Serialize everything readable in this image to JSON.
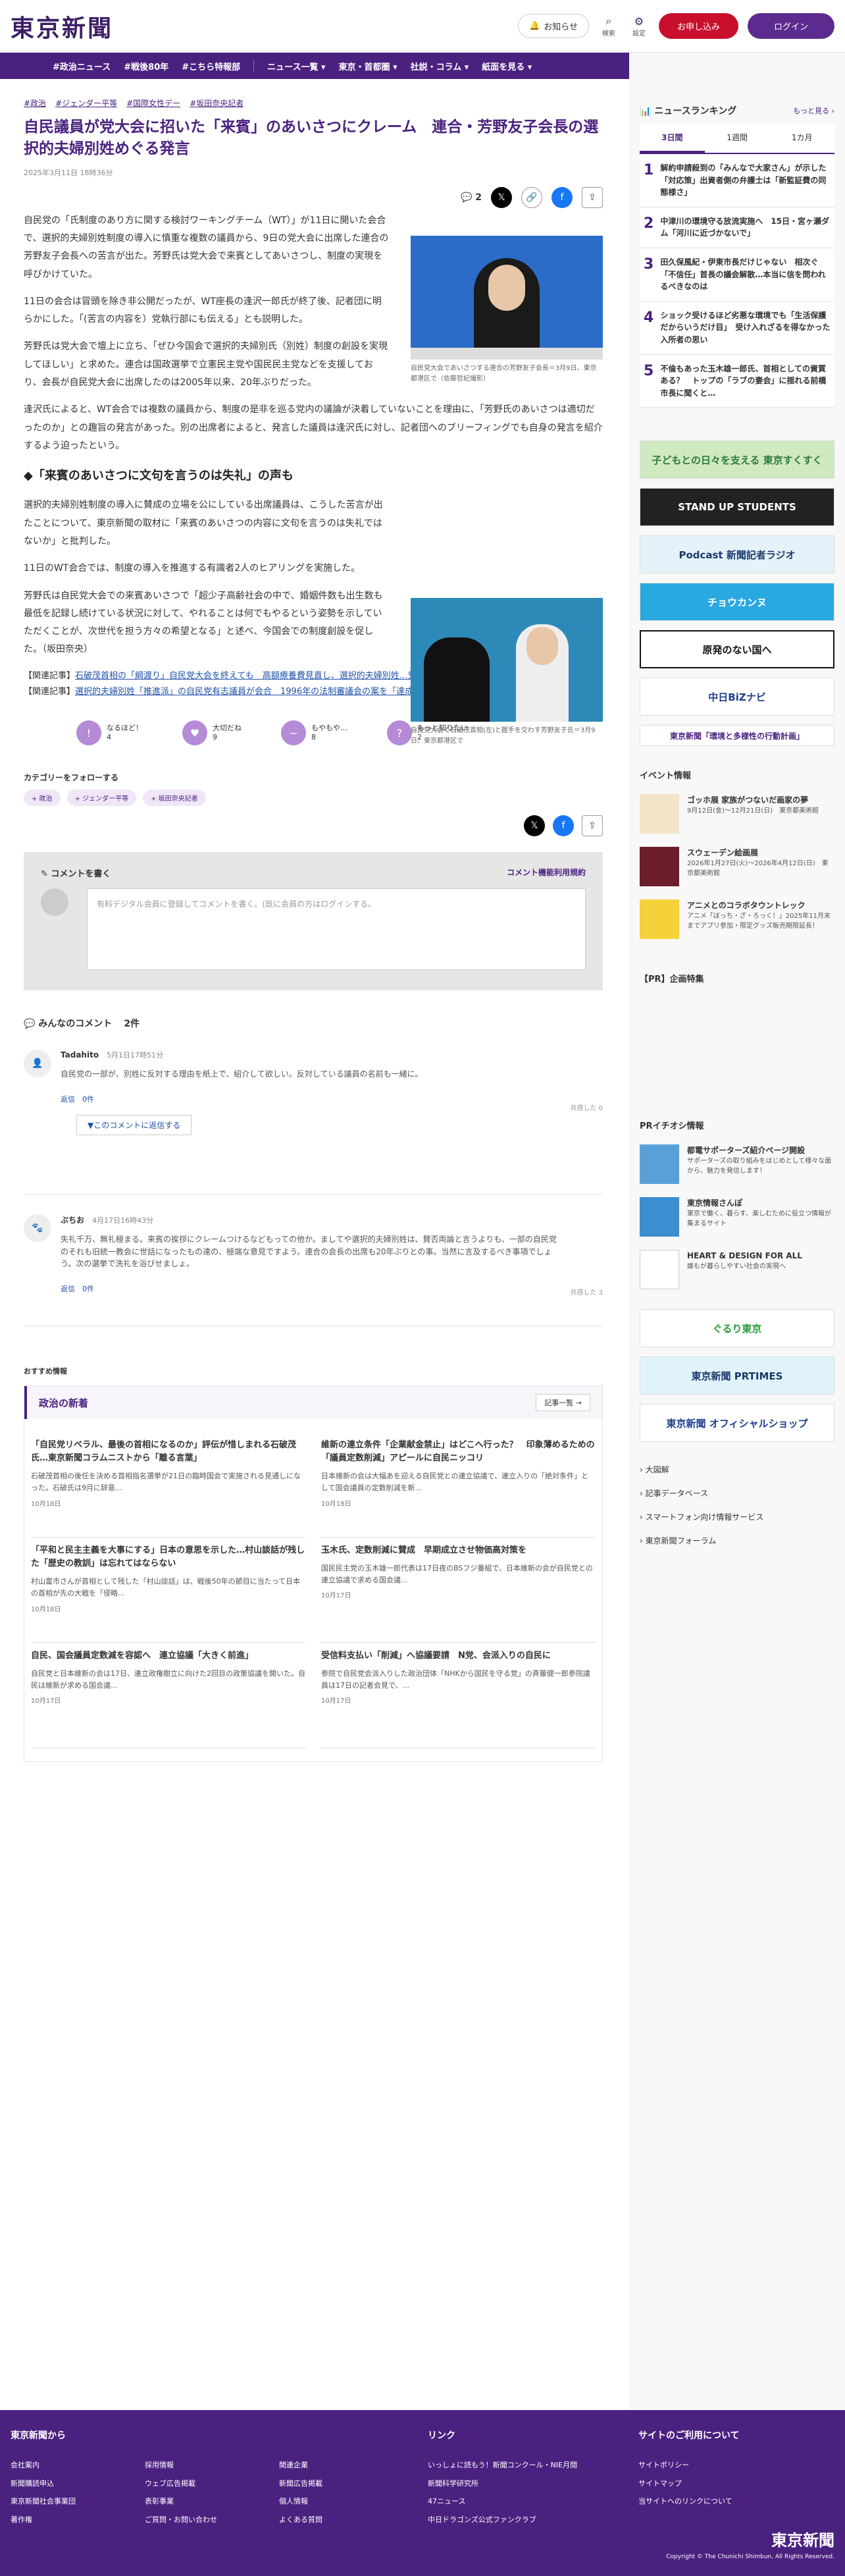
{
  "header": {
    "logo": "東京新聞",
    "notice": "お知らせ",
    "search": "検索",
    "settings": "設定",
    "subscribe": "お申し込み",
    "login": "ログイン"
  },
  "nav": [
    "#政治ニュース",
    "#戦後80年",
    "#こちら特報部",
    "ニュース一覧 ▾",
    "東京・首都圏 ▾",
    "社説・コラム ▾",
    "紙面を見る ▾"
  ],
  "article": {
    "tags": [
      "#政治",
      "#ジェンダー平等",
      "#国際女性デー",
      "#坂田奈央記者"
    ],
    "title": "自民議員が党大会に招いた「来賓」のあいさつにクレーム　連合・芳野友子会長の選択的夫婦別姓めぐる発言",
    "date": "2025年3月11日 18時36分",
    "comment_count": "2",
    "p1": "自民党の「氏制度のあり方に関する検討ワーキングチーム（WT）」が11日に開いた会合で、選択的夫婦別姓制度の導入に慎重な複数の議員から、9日の党大会に出席した連合の芳野友子会長への苦言が出た。芳野氏は党大会で来賓としてあいさつし、制度の実現を呼びかけていた。",
    "p2": "11日の会合は冒頭を除き非公開だったが、WT座長の逢沢一郎氏が終了後、記者団に明らかにした。「(苦言の内容を）党執行部にも伝える」とも説明した。",
    "p3": "芳野氏は党大会で壇上に立ち、「ぜひ今国会で選択的夫婦別氏（別姓）制度の創設を実現してほしい」と求めた。連合は国政選挙で立憲民主党や国民民主党などを支援しており、会長が自民党大会に出席したのは2005年以来、20年ぶりだった。",
    "p4": "逢沢氏によると、WT会合では複数の議員から、制度の是非を巡る党内の議論が決着していないことを理由に、「芳野氏のあいさつは適切だったのか」との趣旨の発言があった。別の出席者によると、発言した議員は逢沢氏に対し、記者団へのブリーフィングでも自身の発言を紹介するよう迫ったという。",
    "fig1_caption": "自民党大会であいさつする連合の芳野友子会長＝3月9日、東京都港区で（佐藤哲紀撮影）",
    "h2": "「来賓のあいさつに文句を言うのは失礼」の声も",
    "p5": "選択的夫婦別姓制度の導入に賛成の立場を公にしている出席議員は、こうした苦言が出たことについて、東京新聞の取材に「来賓のあいさつの内容に文句を言うのは失礼ではないか」と批判した。",
    "p6": "11日のWT会合では、制度の導入を推進する有識者2人のヒアリングを実施した。",
    "p7": "芳野氏は自民党大会での来賓あいさつで「超少子高齢社会の中で、婚姻件数も出生数も最低を記録し続けている状況に対して、やれることは何でもやるという姿勢を示していただくことが、次世代を担う方々の希望となる」と述べ、今国会での制度創設を促した。（坂田奈央）",
    "fig2_caption": "自民党大会で石破茂首相(左)と握手を交わす芳野友子氏＝3月9日、東京都港区で",
    "related_label": "【関連記事】",
    "related1": "石破茂首相の「綱渡り」自民党大会を終えても　高額療養費見直し、選択的夫婦別姓…党内には不満がくすぶる",
    "related2": "選択的夫婦別姓「推進派」の自民党有志議員が会合　1996年の法制審議会の案を「達成目標に」"
  },
  "reactions": [
    {
      "label": "なるほど！",
      "count": "4",
      "icon": "!"
    },
    {
      "label": "大切だね",
      "count": "9",
      "icon": "♥"
    },
    {
      "label": "もやもや…",
      "count": "8",
      "icon": "~"
    },
    {
      "label": "もっと知りたい",
      "count": "2",
      "icon": "?"
    }
  ],
  "follow": {
    "title": "カテゴリーをフォローする",
    "cats": [
      "+ 政治",
      "+ ジェンダー平等",
      "+ 坂田奈央記者"
    ]
  },
  "comment_box": {
    "title": "コメントを書く",
    "policy": "コメント機能利用規約",
    "prompt": "有料デジタル会員に登録してコメントを書く。(既に会員の方はログインする。"
  },
  "comments_header": {
    "title": "みんなのコメント",
    "count": "2件"
  },
  "comments": [
    {
      "name": "Tadahito",
      "time": "5月1日17時51分",
      "text": "自民党の一部が、別姓に反対する理由を紙上で、紹介して欲しい。反対している議員の名前も一緒に。",
      "replies": "返信　0件",
      "likes": "共感した 0",
      "reply_btn": "▼このコメントに返信する"
    },
    {
      "name": "ぶちお",
      "time": "4月17日16時43分",
      "text": "失礼千万、無礼極まる。来賓の挨拶にクレームつけるなどもっての他か。ましてや選択的夫婦別姓は、賛否両論と言うよりも、一部の自民党のそれも旧統一教会に世話になったもの達の、極端な意見ですよう。連合の会長の出席も20年ぶりとの事。当然に言及するべき事項でしょう。次の選挙で洗礼を浴びせましょ。",
      "replies": "返信　0件",
      "likes": "共感した 3"
    }
  ],
  "osusume": "おすすめ情報",
  "newsbox": {
    "title": "政治の新着",
    "more": "記事一覧 →",
    "items": [
      {
        "title": "「自民党リベラル、最後の首相になるのか」評伝が惜しまれる石破茂氏…東京新聞コラムニストから「離る言葉」",
        "desc": "石破茂首相の後任を決める首相指名選挙が21日の臨時国会で実施される見通しになった。石破氏は9月に辞意...",
        "date": "10月18日"
      },
      {
        "title": "維新の連立条件「企業献金禁止」はどこへ行った？　印象薄めるための「議員定数削減」アピールに自民ニッコリ",
        "desc": "日本維新の会は大幅あを迎える自民党との連立協議で、連立入りの「絶対条件」として国会議員の定数削減を新...",
        "date": "10月18日"
      },
      {
        "title": "「平和と民主主義を大事にする」日本の意思を示した…村山談話が残した「歴史の教訓」は忘れてはならない",
        "desc": "村山富市さんが首相として残した「村山談話」は、戦後50年の節目に当たって日本の首相が先の大戦を「侵略...",
        "date": "10月18日"
      },
      {
        "title": "玉木氏、定数削減に賛成　早期成立させ物価高対策を",
        "desc": "国民民主党の玉木雄一郎代表は17日夜のBSフジ番組で、日本維新の会が自民党との連立協議で求める国会議...",
        "date": "10月17日"
      },
      {
        "title": "自民、国会議員定数減を容認へ　連立協議「大きく前進」",
        "desc": "自民党と日本維新の会は17日、連立政権樹立に向けた2回目の政策協議を開いた。自民は維新が求める国会議...",
        "date": "10月17日"
      },
      {
        "title": "受信料支払い「削減」へ協議要請　N党、会派入りの自民に",
        "desc": "参院で自民党会派入りした政治団体「NHKから国民を守る党」の斉藤健一郎参院議員は17日の記者会見で、...",
        "date": "10月17日"
      }
    ]
  },
  "ranking": {
    "title": "ニュースランキング",
    "more": "もっと見る ›",
    "tabs": [
      "3日間",
      "1週間",
      "1カ月"
    ],
    "items": [
      "解約申請殺到の「みんなで大家さん」が示した「対応策」出資者側の弁護士は「新監証費の同態様さ」",
      "中津川の環境守る放流実施へ　15日・宮ヶ瀬ダム「河川に近づかないで」",
      "田久保風紀・伊東市長だけじゃない　相次ぐ「不信任」首長の議会解散…本当に信を問われるべきなのは",
      "ショック受けるほど劣悪な環境でも「生活保護だからいうだけ目」　受け入れざるを得なかった入所者の思い",
      "不倫もあった玉木雄一郎氏、首相としての資質ある？　トップの「ラブの妻会」に揺れる前橋市長に聞くと…"
    ]
  },
  "banners": [
    "子どもとの日々を支える 東京すくすく",
    "STAND UP STUDENTS",
    "Podcast 新聞記者ラジオ",
    "チョウカンヌ",
    "原発のない国へ",
    "中日BiZナビ",
    "東京新聞「環境と多様性の行動計画」"
  ],
  "events": {
    "title": "イベント情報",
    "items": [
      {
        "title": "ゴッホ展 家族がつないだ画家の夢",
        "sub": "9月12日(金)～12月21日(日)　東京都美術館"
      },
      {
        "title": "スウェーデン絵画展",
        "sub": "2026年1月27日(火)～2026年4月12日(日)　東京都美術館"
      },
      {
        "title": "アニメとのコラボタウントレック",
        "sub": "アニメ「ぼっち・ざ・ろっく！」2025年11月末までアプリ参加・限定グッズ販売期限延長！"
      }
    ]
  },
  "pr": "【PR】企画特集",
  "pr_info": {
    "title": "PRイチオシ情報",
    "items": [
      {
        "title": "都電サポーターズ紹介ページ開設",
        "sub": "サポーターズの取り組みをはじめとして様々な面から、魅力を発信します！"
      },
      {
        "title": "東京情報さんぽ",
        "sub": "東京で働く、暮らす、楽しむために役立つ情報が集まるサイト"
      },
      {
        "title": "HEART & DESIGN FOR ALL",
        "sub": "誰もが暮らしやすい社会の実現へ"
      }
    ]
  },
  "side_banners": [
    "ぐるり東京",
    "東京新聞 PRTIMES",
    "東京新聞 オフィシャルショップ"
  ],
  "side_links": [
    "大図解",
    "記事データベース",
    "スマートフォン向け情報サービス",
    "東京新聞フォーラム"
  ],
  "footer": {
    "col1_title": "東京新聞から",
    "col1": [
      "会社案内",
      "新聞購読申込",
      "東京新聞社会事業団",
      "著作権"
    ],
    "col2": [
      "採用情報",
      "ウェブ広告掲載",
      "表彰事業",
      "ご質問・お問い合わせ"
    ],
    "col3": [
      "関連企業",
      "新聞広告掲載",
      "個人情報",
      "よくある質問"
    ],
    "col4_title": "リンク",
    "col4": [
      "いっしょに読もう！新聞コンクール・NIE月間",
      "新聞科学研究所",
      "47ニュース",
      "中日ドラゴンズ公式ファンクラブ"
    ],
    "col5_title": "サイトのご利用について",
    "col5": [
      "サイトポリシー",
      "サイトマップ",
      "当サイトへのリンクについて"
    ],
    "copyright": "Copyright © The Chunichi Shimbun, All Rights Reserved.",
    "logo": "東京新聞"
  }
}
